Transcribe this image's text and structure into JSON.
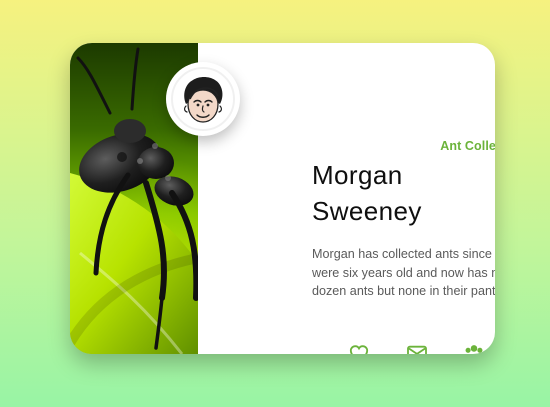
{
  "profile_card": {
    "role_label": "Ant Collector",
    "name_first": "Morgan",
    "name_last": "Sweeney",
    "bio": "Morgan has collected ants since they were six years old and now has many dozen ants but none in their pants.",
    "actions": [
      {
        "icon": "heart-icon",
        "name": "like"
      },
      {
        "icon": "envelope-icon",
        "name": "message"
      },
      {
        "icon": "users-icon",
        "name": "group"
      }
    ],
    "accent_color": "#6bb33a"
  }
}
